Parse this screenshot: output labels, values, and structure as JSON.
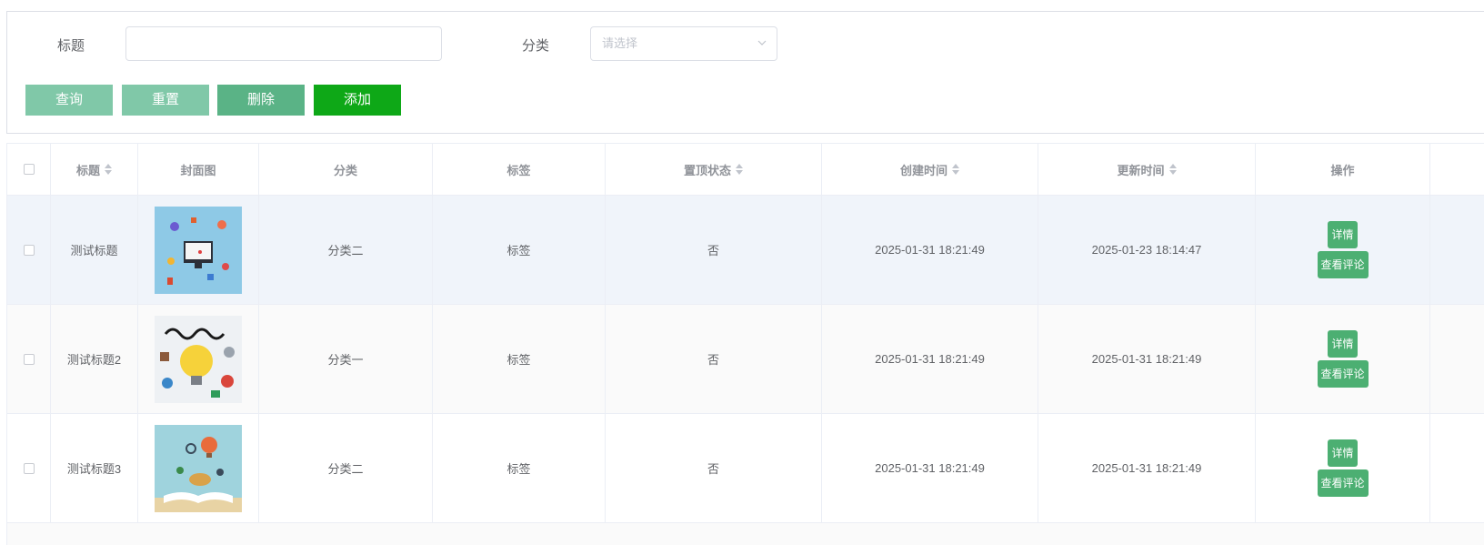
{
  "search": {
    "title_label": "标题",
    "title_value": "",
    "category_label": "分类",
    "category_placeholder": "请选择"
  },
  "buttons": {
    "query": "查询",
    "reset": "重置",
    "delete": "删除",
    "add": "添加"
  },
  "colors": {
    "query_btn": "#80c8a8",
    "reset_btn": "#80c8a8",
    "delete_btn": "#5ab386",
    "add_btn": "#0ea817",
    "op_btn": "#4caf72"
  },
  "table": {
    "headers": {
      "title": "标题",
      "cover": "封面图",
      "category": "分类",
      "tag": "标签",
      "pinned": "置顶状态",
      "created": "创建时间",
      "updated": "更新时间",
      "actions": "操作"
    },
    "rows": [
      {
        "title": "测试标题",
        "category": "分类二",
        "tag": "标签",
        "pinned": "否",
        "created": "2025-01-31 18:21:49",
        "updated": "2025-01-23 18:14:47",
        "detail": "详情",
        "comments": "查看评论",
        "cover_icon": "tech-illustration"
      },
      {
        "title": "测试标题2",
        "category": "分类一",
        "tag": "标签",
        "pinned": "否",
        "created": "2025-01-31 18:21:49",
        "updated": "2025-01-31 18:21:49",
        "detail": "详情",
        "comments": "查看评论",
        "cover_icon": "learn-lightbulb-illustration"
      },
      {
        "title": "测试标题3",
        "category": "分类二",
        "tag": "标签",
        "pinned": "否",
        "created": "2025-01-31 18:21:49",
        "updated": "2025-01-31 18:21:49",
        "detail": "详情",
        "comments": "查看评论",
        "cover_icon": "open-book-illustration"
      }
    ]
  }
}
